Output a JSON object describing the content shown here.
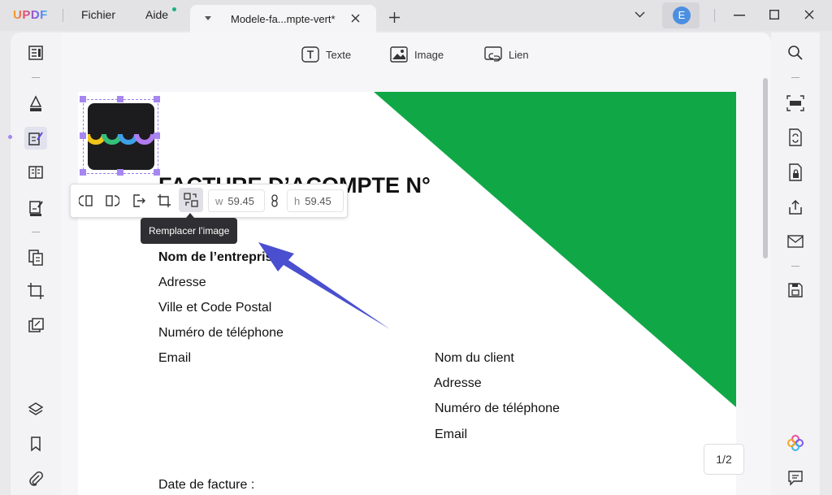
{
  "app": {
    "brand": "UPDF",
    "menu": {
      "file": "Fichier",
      "help": "Aide"
    },
    "tab": {
      "title": "Modele-fa...mpte-vert*"
    },
    "user_initial": "E"
  },
  "toolbar": {
    "text": "Texte",
    "image": "Image",
    "link": "Lien"
  },
  "image_toolbar": {
    "w_label": "w",
    "w_value": "59.45",
    "h_label": "h",
    "h_value": "59.45",
    "tooltip": "Remplacer l’image"
  },
  "document": {
    "heading": "FACTURE D’ACOMPTE N°",
    "company_name": "Nom de l’entreprise",
    "address": "Adresse",
    "city": "Ville et Code Postal",
    "phone": "Numéro de téléphone",
    "email": "Email",
    "client_name": "Nom du client",
    "client_address": "Adresse",
    "client_phone": "Numéro de téléphone",
    "client_email": "Email",
    "invoice_date": "Date de facture :"
  },
  "page_indicator": "1/2",
  "colors": {
    "accent": "#a686f0",
    "green": "#10a847",
    "arrow": "#4a4fcf"
  }
}
